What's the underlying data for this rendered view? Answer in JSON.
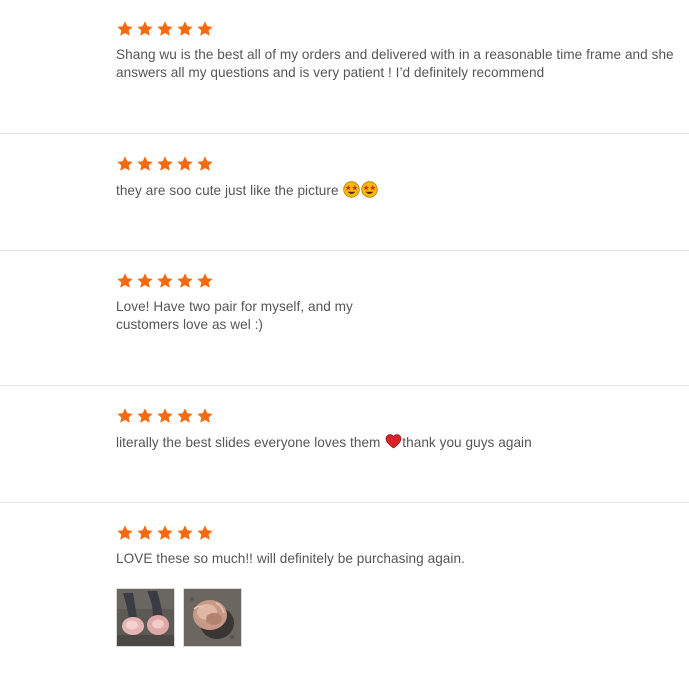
{
  "colors": {
    "star": "#f36b10",
    "text": "#555555",
    "divider": "#e2e2e2"
  },
  "reviews": [
    {
      "rating": 5,
      "text": "Shang wu is the best all of my orders and delivered with in a reasonable time frame and she answers all my questions and is very patient ! I’d definitely recommend"
    },
    {
      "rating": 5,
      "text": "they are soo cute just like the picture",
      "emoji": [
        "star-struck-emoji",
        "star-struck-emoji"
      ]
    },
    {
      "rating": 5,
      "text": "Love! Have two pair for myself, and my customers love as wel :)"
    },
    {
      "rating": 5,
      "text_before": "literally the best slides everyone loves them",
      "emoji": [
        "red-heart-emoji"
      ],
      "text_after": "thank you guys again"
    },
    {
      "rating": 5,
      "text": "LOVE these so much!! will definitely be purchasing again.",
      "photos": [
        "feet-in-fur-slides-photo",
        "fur-slide-on-ground-photo"
      ]
    }
  ]
}
